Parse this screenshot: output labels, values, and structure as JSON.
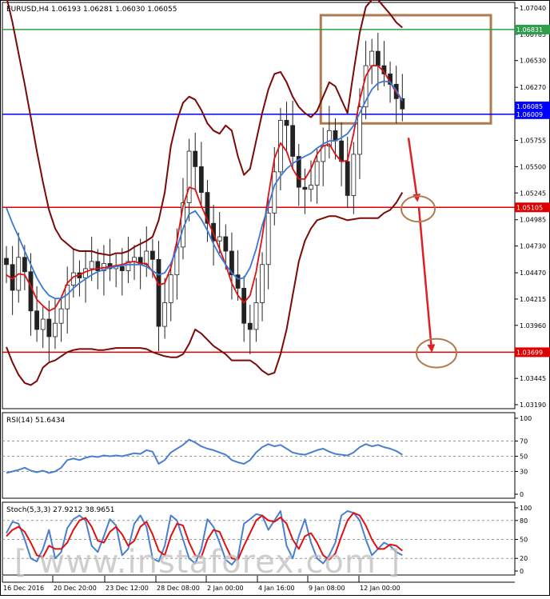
{
  "chart_data": [
    {
      "type": "line",
      "header": "EURUSD,H4  1.06193 1.06281 1.06030 1.06055",
      "y_ticks": [
        "1.07040",
        "1.06785",
        "1.06530",
        "1.06270",
        "1.06015",
        "1.05755",
        "1.05500",
        "1.05245",
        "1.04985",
        "1.04730",
        "1.04470",
        "1.04215",
        "1.03960",
        "1.03700",
        "1.03445",
        "1.03190"
      ],
      "ylim": [
        1.0319,
        1.0704
      ],
      "x_labels": [
        "16 Dec 2016",
        "20 Dec 20:00",
        "23 Dec 12:00",
        "28 Dec 08:00",
        "2 Jan 00:00",
        "4 Jan 16:00",
        "9 Jan 08:00",
        "12 Jan 00:00"
      ],
      "price_levels": [
        {
          "label": "1.06831",
          "value": 1.06831,
          "color": "#2e9e4a"
        },
        {
          "label": "1.06085",
          "value": 1.06085,
          "color": "#0000ff"
        },
        {
          "label": "1.06009",
          "value": 1.06009,
          "color": "#0000ff"
        },
        {
          "label": "1.05105",
          "value": 1.05105,
          "color": "#dd0000"
        },
        {
          "label": "1.03699",
          "value": 1.03699,
          "color": "#dd0000"
        }
      ],
      "close": [
        1.0455,
        1.043,
        1.0462,
        1.0448,
        1.041,
        1.0392,
        1.0402,
        1.0385,
        1.0398,
        1.0412,
        1.0435,
        1.0447,
        1.0442,
        1.0451,
        1.0458,
        1.0449,
        1.0456,
        1.0451,
        1.0453,
        1.0449,
        1.0458,
        1.0462,
        1.0455,
        1.0468,
        1.046,
        1.0395,
        1.0418,
        1.0445,
        1.0472,
        1.0515,
        1.0565,
        1.055,
        1.0525,
        1.0495,
        1.0478,
        1.0482,
        1.0468,
        1.0445,
        1.0432,
        1.0398,
        1.0392,
        1.0418,
        1.0455,
        1.0505,
        1.0545,
        1.0595,
        1.059,
        1.056,
        1.053,
        1.0528,
        1.0532,
        1.0555,
        1.057,
        1.0585,
        1.0575,
        1.0555,
        1.0522,
        1.0562,
        1.0608,
        1.0648,
        1.0662,
        1.0648,
        1.064,
        1.063,
        1.0616,
        1.0606
      ],
      "series": [
        {
          "key": "ma_red",
          "color": "#dd1111",
          "values": [
            1.0445,
            1.0441,
            1.0446,
            1.0445,
            1.0434,
            1.0421,
            1.0415,
            1.041,
            1.0413,
            1.0423,
            1.0437,
            1.0443,
            1.0445,
            1.0448,
            1.045,
            1.0451,
            1.0452,
            1.0453,
            1.0454,
            1.0455,
            1.0457,
            1.0458,
            1.0456,
            1.0456,
            1.0448,
            1.0435,
            1.0437,
            1.0452,
            1.0478,
            1.0512,
            1.053,
            1.0528,
            1.0512,
            1.0498,
            1.0485,
            1.047,
            1.0455,
            1.0437,
            1.0425,
            1.0418,
            1.0425,
            1.0448,
            1.0482,
            1.0522,
            1.0558,
            1.0573,
            1.0565,
            1.0548,
            1.0538,
            1.0538,
            1.0548,
            1.0562,
            1.057,
            1.0572,
            1.0562,
            1.0555,
            1.0556,
            1.0582,
            1.0615,
            1.0638,
            1.0648,
            1.0648,
            1.0642,
            1.0632,
            1.0622,
            1.0614
          ]
        },
        {
          "key": "ma_blue",
          "color": "#3a78d6",
          "values": [
            1.051,
            1.0495,
            1.0482,
            1.0468,
            1.0455,
            1.0442,
            1.0432,
            1.0425,
            1.0422,
            1.0422,
            1.0426,
            1.0432,
            1.0437,
            1.0441,
            1.0445,
            1.0448,
            1.045,
            1.0452,
            1.0453,
            1.0454,
            1.0455,
            1.0455,
            1.0455,
            1.0453,
            1.0449,
            1.0445,
            1.0447,
            1.0456,
            1.0471,
            1.049,
            1.0504,
            1.0507,
            1.0499,
            1.0488,
            1.0475,
            1.0464,
            1.0455,
            1.0447,
            1.0441,
            1.0442,
            1.0452,
            1.047,
            1.0493,
            1.0512,
            1.0532,
            1.0541,
            1.0548,
            1.0553,
            1.0557,
            1.056,
            1.0563,
            1.0568,
            1.0572,
            1.0575,
            1.0575,
            1.0578,
            1.0582,
            1.059,
            1.0602,
            1.0614,
            1.0625,
            1.0631,
            1.0633,
            1.0632,
            1.0624,
            1.0614
          ]
        },
        {
          "key": "bb_upper",
          "color": "#7a0a0a",
          "values": [
            1.0715,
            1.069,
            1.066,
            1.063,
            1.0598,
            1.0565,
            1.0535,
            1.0508,
            1.049,
            1.048,
            1.0475,
            1.047,
            1.0468,
            1.0468,
            1.0468,
            1.0466,
            1.0465,
            1.0464,
            1.0466,
            1.0466,
            1.0468,
            1.0472,
            1.0475,
            1.0478,
            1.0482,
            1.0498,
            1.0525,
            1.057,
            1.0595,
            1.0612,
            1.0618,
            1.0615,
            1.0605,
            1.0592,
            1.0585,
            1.0582,
            1.059,
            1.0585,
            1.056,
            1.0542,
            1.0548,
            1.0575,
            1.0602,
            1.0625,
            1.064,
            1.0642,
            1.0632,
            1.0618,
            1.0608,
            1.0602,
            1.0598,
            1.0604,
            1.0618,
            1.0632,
            1.0628,
            1.0615,
            1.0602,
            1.0642,
            1.068,
            1.0705,
            1.0712,
            1.0712,
            1.0705,
            1.0698,
            1.069,
            1.0685
          ]
        },
        {
          "key": "bb_lower",
          "color": "#7a0a0a",
          "values": [
            1.0375,
            1.036,
            1.0348,
            1.034,
            1.0338,
            1.0342,
            1.0355,
            1.036,
            1.0362,
            1.0366,
            1.037,
            1.0372,
            1.0373,
            1.0373,
            1.0373,
            1.0372,
            1.0372,
            1.0373,
            1.0374,
            1.0374,
            1.0374,
            1.0374,
            1.0374,
            1.0373,
            1.037,
            1.0368,
            1.0366,
            1.0365,
            1.0365,
            1.0368,
            1.0378,
            1.0392,
            1.0388,
            1.0382,
            1.0376,
            1.0372,
            1.0368,
            1.0362,
            1.0362,
            1.0362,
            1.0362,
            1.0358,
            1.0352,
            1.0348,
            1.035,
            1.0368,
            1.0392,
            1.0425,
            1.0458,
            1.0478,
            1.049,
            1.0498,
            1.05,
            1.0502,
            1.0502,
            1.05,
            1.0498,
            1.0499,
            1.05,
            1.05,
            1.05,
            1.05,
            1.0505,
            1.0508,
            1.0515,
            1.0525
          ]
        }
      ],
      "ma_red_segment_start": 10
    },
    {
      "type": "line",
      "title": "RSI(14) 51.6434",
      "y_ticks": [
        "100",
        "70",
        "50",
        "30",
        "0"
      ],
      "ylim": [
        0,
        100
      ],
      "levels": [
        70,
        50,
        30
      ],
      "series": [
        {
          "key": "rsi",
          "color": "#4a7fd0",
          "values": [
            28,
            30,
            32,
            35,
            31,
            29,
            31,
            28,
            30,
            35,
            45,
            47,
            45,
            48,
            50,
            49,
            51,
            50,
            51,
            50,
            52,
            54,
            53,
            58,
            56,
            40,
            45,
            55,
            60,
            65,
            72,
            68,
            63,
            60,
            58,
            55,
            52,
            45,
            42,
            40,
            45,
            55,
            62,
            66,
            63,
            65,
            60,
            55,
            53,
            52,
            55,
            58,
            60,
            56,
            53,
            52,
            51,
            55,
            62,
            66,
            63,
            65,
            62,
            60,
            57,
            52
          ]
        }
      ]
    },
    {
      "type": "line",
      "title": "Stoch(5,3,3) 27.9212 38.9651",
      "y_ticks": [
        "100",
        "80",
        "50",
        "20",
        "0"
      ],
      "ylim": [
        0,
        100
      ],
      "levels": [
        80,
        50,
        20
      ],
      "series": [
        {
          "key": "stoch_main",
          "color": "#4a7fd0",
          "values": [
            60,
            78,
            75,
            50,
            20,
            15,
            35,
            65,
            20,
            30,
            68,
            82,
            88,
            80,
            40,
            30,
            55,
            82,
            72,
            25,
            35,
            75,
            88,
            70,
            20,
            15,
            40,
            88,
            80,
            50,
            20,
            12,
            35,
            82,
            70,
            45,
            18,
            10,
            22,
            75,
            82,
            90,
            88,
            65,
            80,
            95,
            40,
            20,
            55,
            82,
            45,
            20,
            12,
            25,
            45,
            88,
            95,
            92,
            80,
            50,
            25,
            35,
            45,
            40,
            30,
            25
          ]
        },
        {
          "key": "stoch_signal",
          "color": "#dd1111",
          "values": [
            55,
            65,
            70,
            62,
            45,
            25,
            22,
            40,
            35,
            35,
            45,
            65,
            80,
            84,
            70,
            48,
            45,
            62,
            70,
            58,
            40,
            48,
            70,
            78,
            58,
            32,
            25,
            55,
            75,
            72,
            45,
            25,
            22,
            50,
            65,
            62,
            40,
            20,
            18,
            40,
            60,
            80,
            88,
            80,
            78,
            85,
            75,
            50,
            35,
            55,
            60,
            45,
            25,
            18,
            28,
            55,
            80,
            92,
            88,
            72,
            50,
            35,
            35,
            42,
            40,
            32
          ]
        }
      ]
    }
  ]
}
